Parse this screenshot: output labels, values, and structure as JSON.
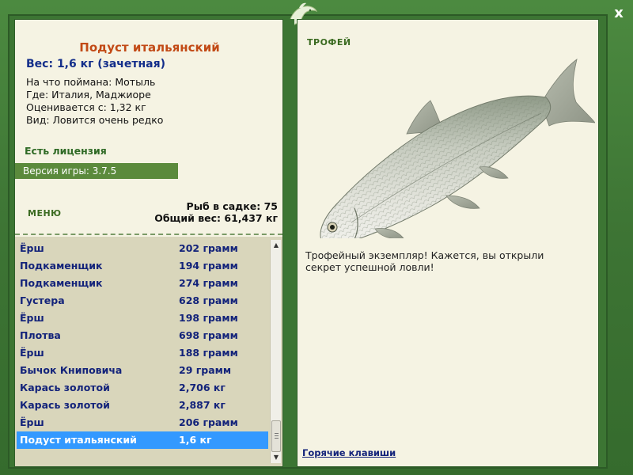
{
  "window": {
    "close_label": "x",
    "emblem_icon": "dolphin-emblem-icon"
  },
  "catch": {
    "title": "Подуст итальянский",
    "weight": "Вес: 1,6 кг (зачетная)",
    "bait": "На что поймана: Мотыль",
    "location": "Где: Италия, Маджиоре",
    "valued_from": "Оценивается с: 1,32 кг",
    "rarity": "Вид: Ловится очень редко"
  },
  "license": "Есть лицензия",
  "version": "Версия игры: 3.7.5",
  "menu_label": "МЕНЮ",
  "keepnet": {
    "count": "Рыб в садке: 75",
    "total_weight": "Общий вес: 61,437 кг"
  },
  "fish_list": [
    {
      "name": "Ёрш",
      "weight": "202 грамм"
    },
    {
      "name": "Подкаменщик",
      "weight": "194 грамм"
    },
    {
      "name": "Подкаменщик",
      "weight": "274 грамм"
    },
    {
      "name": "Густера",
      "weight": "628 грамм"
    },
    {
      "name": "Ёрш",
      "weight": "198 грамм"
    },
    {
      "name": "Плотва",
      "weight": "698 грамм"
    },
    {
      "name": "Ёрш",
      "weight": "188 грамм"
    },
    {
      "name": "Бычок Книповича",
      "weight": "29 грамм"
    },
    {
      "name": "Карась золотой",
      "weight": "2,706 кг"
    },
    {
      "name": "Карась золотой",
      "weight": "2,887 кг"
    },
    {
      "name": "Ёрш",
      "weight": "206 грамм"
    },
    {
      "name": "Подуст итальянский",
      "weight": "1,6 кг"
    }
  ],
  "selected_index": 11,
  "scroll_up_glyph": "▲",
  "scroll_down_glyph": "▼",
  "trophy": {
    "label": "ТРОФЕЙ",
    "caption": "Трофейный экземпляр! Кажется, вы открыли секрет успешной ловли!"
  },
  "hotkeys_label": "Горячие клавиши",
  "colors": {
    "frame_green": "#3e7a35",
    "panel_bg": "#f5f3e3",
    "title_orange": "#c24a16",
    "text_blue": "#13237a",
    "selection_blue": "#3399ff",
    "version_bar": "#5b8a3c"
  }
}
